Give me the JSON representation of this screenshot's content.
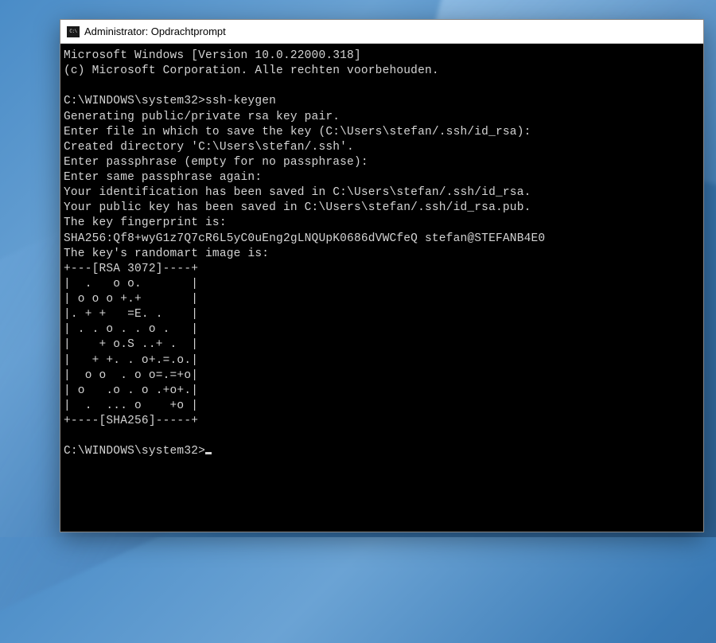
{
  "window": {
    "title": "Administrator: Opdrachtprompt"
  },
  "terminal": {
    "lines": [
      "Microsoft Windows [Version 10.0.22000.318]",
      "(c) Microsoft Corporation. Alle rechten voorbehouden.",
      "",
      "C:\\WINDOWS\\system32>ssh-keygen",
      "Generating public/private rsa key pair.",
      "Enter file in which to save the key (C:\\Users\\stefan/.ssh/id_rsa):",
      "Created directory 'C:\\Users\\stefan/.ssh'.",
      "Enter passphrase (empty for no passphrase):",
      "Enter same passphrase again:",
      "Your identification has been saved in C:\\Users\\stefan/.ssh/id_rsa.",
      "Your public key has been saved in C:\\Users\\stefan/.ssh/id_rsa.pub.",
      "The key fingerprint is:",
      "SHA256:Qf8+wyG1z7Q7cR6L5yC0uEng2gLNQUpK0686dVWCfeQ stefan@STEFANB4E0",
      "The key's randomart image is:",
      "+---[RSA 3072]----+",
      "|  .   o o.       |",
      "| o o o +.+       |",
      "|. + +   =E. .    |",
      "| . . o . . o .   |",
      "|    + o.S ..+ .  |",
      "|   + +. . o+.=.o.|",
      "|  o o  . o o=.=+o|",
      "| o   .o . o .+o+.|",
      "|  .  ... o    +o |",
      "+----[SHA256]-----+",
      "",
      "C:\\WINDOWS\\system32>"
    ]
  }
}
